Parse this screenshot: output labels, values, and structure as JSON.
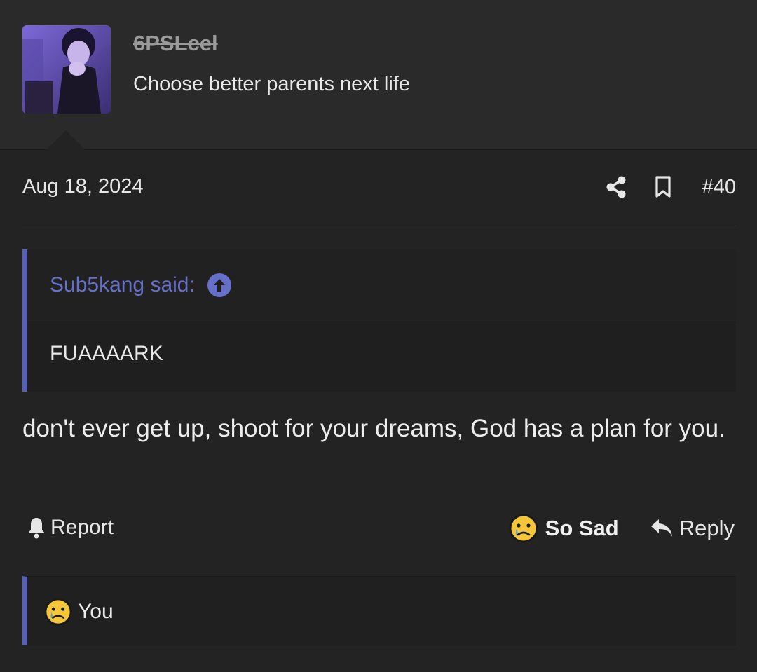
{
  "author": {
    "username": "6PSLcel",
    "user_title": "Choose better parents next life"
  },
  "post": {
    "date": "Aug 18, 2024",
    "number": "#40",
    "message": "don't ever get up, shoot for your dreams, God has a plan for you."
  },
  "quote": {
    "author_label": "Sub5kang said:",
    "body": "FUAAAARK"
  },
  "actions": {
    "report_label": "Report",
    "reaction_label": "So Sad",
    "reply_label": "Reply"
  },
  "reactions": {
    "summary": "You"
  },
  "colors": {
    "accent": "#5660b4",
    "background": "#232323",
    "text": "#e6e6e6"
  },
  "icons": [
    "share-icon",
    "bookmark-icon",
    "arrow-up-circle-icon",
    "bell-icon",
    "sad-face-icon",
    "reply-icon"
  ]
}
